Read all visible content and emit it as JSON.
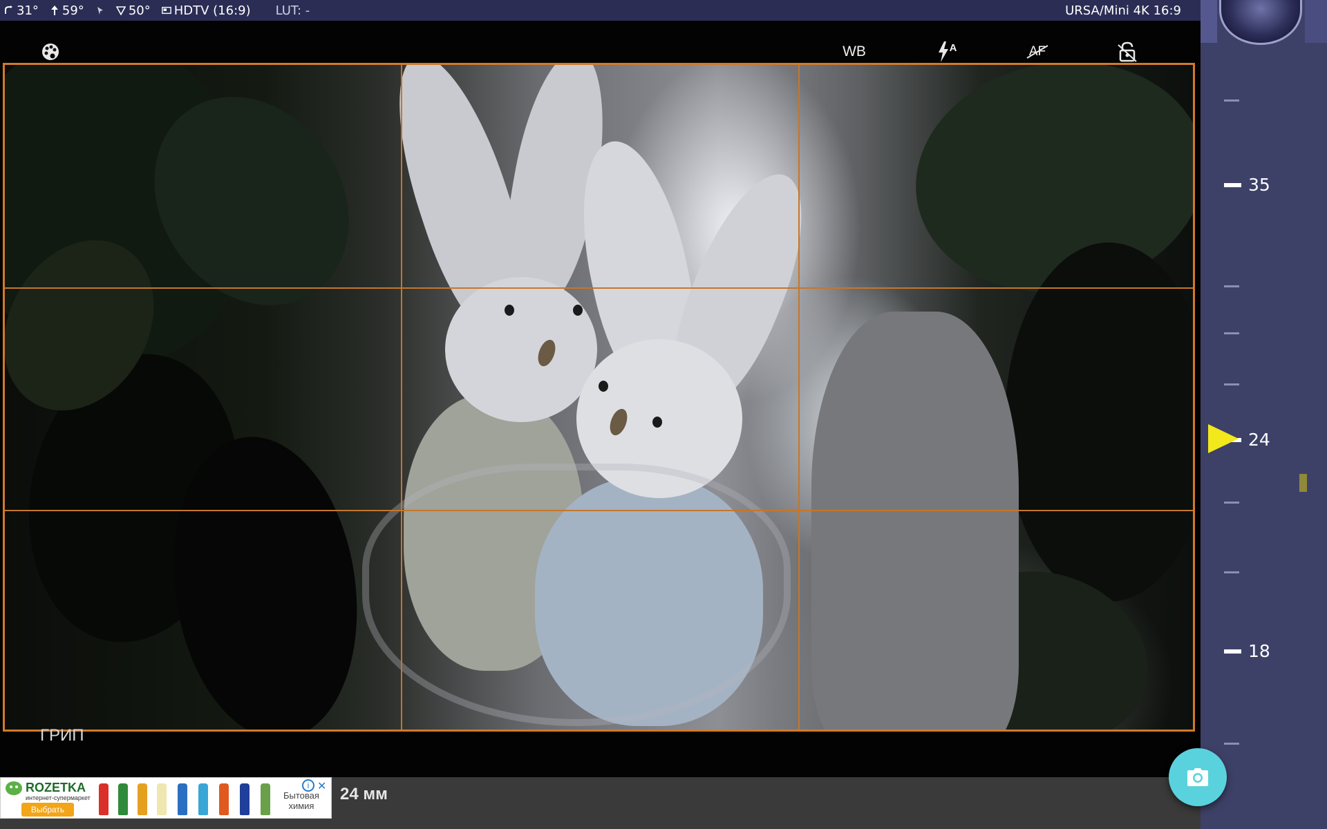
{
  "statusbar": {
    "roll": "31°",
    "pitch": "59°",
    "fov": "50°",
    "format": "HDTV (16:9)",
    "lut": "LUT: -",
    "camera_model": "URSA/Mini 4K 16:9"
  },
  "toolbar": {
    "wb_label": "WB",
    "flash_label": "A",
    "af_label": "AF"
  },
  "viewfinder": {
    "grip_label": "ГРИП"
  },
  "zoom": {
    "labels": [
      "35",
      "24",
      "18"
    ],
    "current": "24"
  },
  "bottom": {
    "focal_length": "24 мм"
  },
  "ad": {
    "brand": "ROZETKA",
    "tagline": "интернет-супермаркет",
    "button": "Выбрать",
    "text_line1": "Бытовая",
    "text_line2": "химия"
  },
  "colors": {
    "grid": "#c4772c",
    "statusbar": "#2b2d55",
    "zoom_panel": "#3e4167",
    "pointer": "#f2e81c",
    "shutter": "#5ad2dd"
  }
}
